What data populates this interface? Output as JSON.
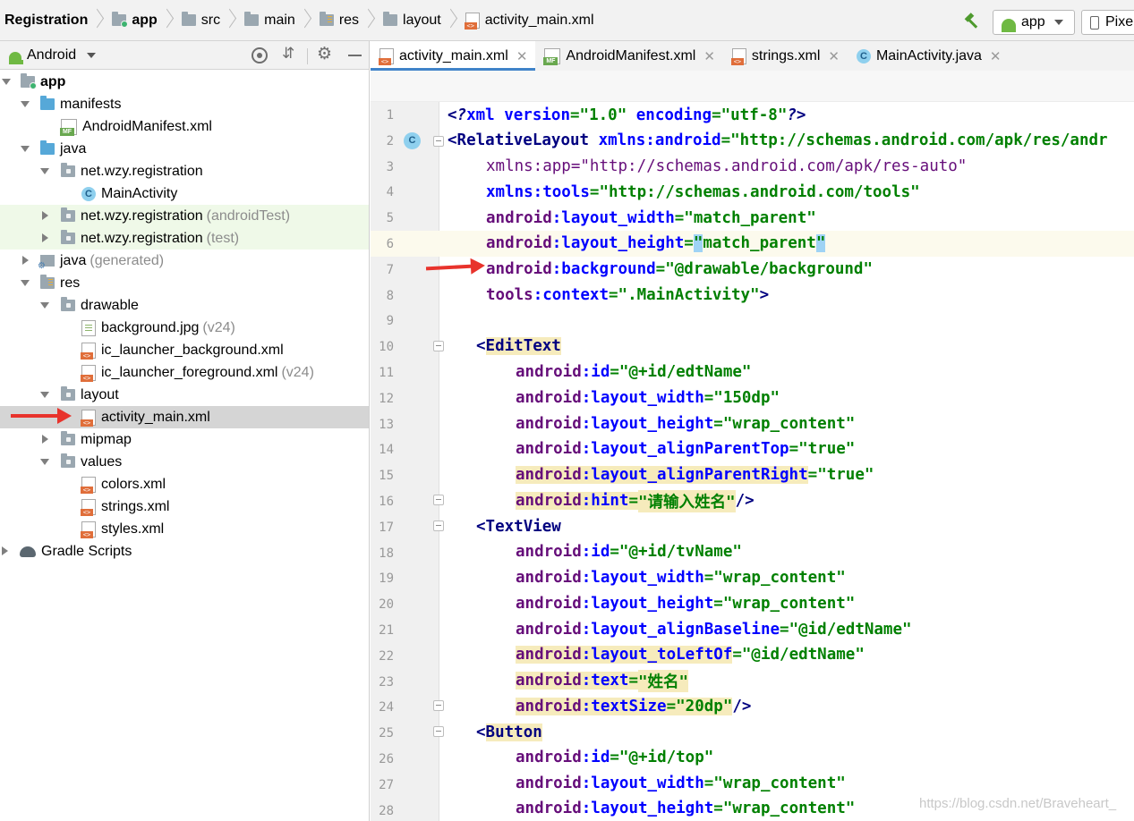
{
  "breadcrumb": {
    "items": [
      {
        "label": "Registration"
      },
      {
        "label": "app"
      },
      {
        "label": "src"
      },
      {
        "label": "main"
      },
      {
        "label": "res"
      },
      {
        "label": "layout"
      },
      {
        "label": "activity_main.xml"
      }
    ]
  },
  "toolbar": {
    "run_config": "app",
    "device": "Pixe"
  },
  "project_panel": {
    "view_label": "Android",
    "tree": [
      {
        "label": "app",
        "extra": ""
      },
      {
        "label": "manifests",
        "extra": ""
      },
      {
        "label": "AndroidManifest.xml",
        "extra": ""
      },
      {
        "label": "java",
        "extra": ""
      },
      {
        "label": "net.wzy.registration",
        "extra": ""
      },
      {
        "label": "MainActivity",
        "extra": ""
      },
      {
        "label": "net.wzy.registration",
        "extra": "(androidTest)"
      },
      {
        "label": "net.wzy.registration",
        "extra": "(test)"
      },
      {
        "label": "java",
        "extra": "(generated)"
      },
      {
        "label": "res",
        "extra": ""
      },
      {
        "label": "drawable",
        "extra": ""
      },
      {
        "label": "background.jpg",
        "extra": "(v24)"
      },
      {
        "label": "ic_launcher_background.xml",
        "extra": ""
      },
      {
        "label": "ic_launcher_foreground.xml",
        "extra": "(v24)"
      },
      {
        "label": "layout",
        "extra": ""
      },
      {
        "label": "activity_main.xml",
        "extra": ""
      },
      {
        "label": "mipmap",
        "extra": ""
      },
      {
        "label": "values",
        "extra": ""
      },
      {
        "label": "colors.xml",
        "extra": ""
      },
      {
        "label": "strings.xml",
        "extra": ""
      },
      {
        "label": "styles.xml",
        "extra": ""
      },
      {
        "label": "Gradle Scripts",
        "extra": ""
      }
    ]
  },
  "editor": {
    "tabs": [
      {
        "label": "activity_main.xml"
      },
      {
        "label": "AndroidManifest.xml"
      },
      {
        "label": "strings.xml"
      },
      {
        "label": "MainActivity.java"
      }
    ],
    "line_numbers": [
      "1",
      "2",
      "3",
      "4",
      "5",
      "6",
      "7",
      "8",
      "9",
      "10",
      "11",
      "12",
      "13",
      "14",
      "15",
      "16",
      "17",
      "18",
      "19",
      "20",
      "21",
      "22",
      "23",
      "24",
      "25",
      "26",
      "27",
      "28"
    ],
    "code": {
      "l1": {
        "a": "<?",
        "b": "xml ",
        "c": "version",
        "d": "=",
        "e": "\"1.0\"",
        "f": " encoding",
        "g": "=",
        "h": "\"utf-8\"",
        "i": "?>"
      },
      "l2": {
        "a": "<",
        "b": "RelativeLayout ",
        "c": "xmlns:",
        "d": "android",
        "e": "=",
        "f": "\"http://schemas.android.com/apk/res/andr"
      },
      "l3": {
        "a": "xmlns:",
        "b": "app",
        "c": "=",
        "d": "\"http://schemas.android.com/apk/res-auto\""
      },
      "l4": {
        "a": "xmlns:",
        "b": "tools",
        "c": "=",
        "d": "\"http://schemas.android.com/tools\""
      },
      "l5": {
        "ns": "android",
        "attr": ":layout_width",
        "eq": "=",
        "val": "\"match_parent\""
      },
      "l6": {
        "ns": "android",
        "attr": ":layout_height",
        "eq": "=",
        "q1": "\"",
        "val": "match_parent",
        "q2": "\""
      },
      "l7": {
        "ns": "android",
        "attr": ":background",
        "eq": "=",
        "val": "\"@drawable/background\""
      },
      "l8": {
        "ns": "tools",
        "attr": ":context",
        "eq": "=",
        "val": "\".MainActivity\"",
        "end": ">"
      },
      "l10": {
        "open": "<",
        "tag": "EditText"
      },
      "l11": {
        "ns": "android",
        "attr": ":id",
        "eq": "=",
        "val": "\"@+id/edtName\""
      },
      "l12": {
        "ns": "android",
        "attr": ":layout_width",
        "eq": "=",
        "val": "\"150dp\""
      },
      "l13": {
        "ns": "android",
        "attr": ":layout_height",
        "eq": "=",
        "val": "\"wrap_content\""
      },
      "l14": {
        "ns": "android",
        "attr": ":layout_alignParentTop",
        "eq": "=",
        "val": "\"true\""
      },
      "l15": {
        "ns": "android",
        "attr": ":layout_alignParentRight",
        "eq": "=",
        "val": "\"true\""
      },
      "l16": {
        "ns": "android",
        "attr": ":hint",
        "eq": "=",
        "val": "\"请输入姓名\"",
        "end": "/>"
      },
      "l17": {
        "open": "<",
        "tag": "TextView"
      },
      "l18": {
        "ns": "android",
        "attr": ":id",
        "eq": "=",
        "val": "\"@+id/tvName\""
      },
      "l19": {
        "ns": "android",
        "attr": ":layout_width",
        "eq": "=",
        "val": "\"wrap_content\""
      },
      "l20": {
        "ns": "android",
        "attr": ":layout_height",
        "eq": "=",
        "val": "\"wrap_content\""
      },
      "l21": {
        "ns": "android",
        "attr": ":layout_alignBaseline",
        "eq": "=",
        "val": "\"@id/edtName\""
      },
      "l22": {
        "ns": "android",
        "attr": ":layout_toLeftOf",
        "eq": "=",
        "val": "\"@id/edtName\""
      },
      "l23": {
        "ns": "android",
        "attr": ":text",
        "eq": "=",
        "val": "\"姓名\""
      },
      "l24": {
        "ns": "android",
        "attr": ":textSize",
        "eq": "=",
        "val": "\"20dp\"",
        "end": "/>"
      },
      "l25": {
        "open": "<",
        "tag": "Button"
      },
      "l26": {
        "ns": "android",
        "attr": ":id",
        "eq": "=",
        "val": "\"@+id/top\""
      },
      "l27": {
        "ns": "android",
        "attr": ":layout_width",
        "eq": "=",
        "val": "\"wrap_content\""
      },
      "l28": {
        "ns": "android",
        "attr": ":layout_height",
        "eq": "=",
        "val": "\"wrap_content\""
      }
    }
  },
  "watermark": "https://blog.csdn.net/Braveheart_",
  "colors": {
    "arrow": "#e8332c",
    "xml_namespace": "#660e7a",
    "xml_attribute": "#0000ff",
    "xml_tag": "#000080",
    "xml_value": "#008000",
    "highlight": "#f6ebbc",
    "selection": "#d5d5d5"
  }
}
